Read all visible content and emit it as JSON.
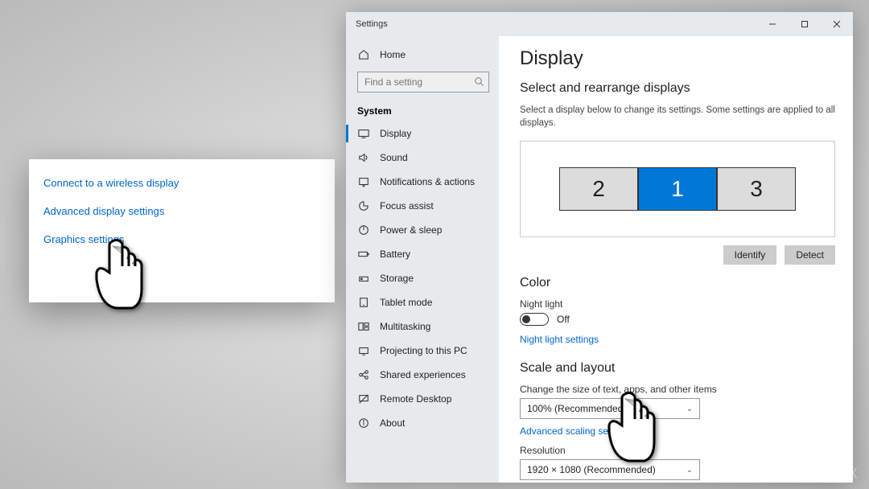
{
  "popup": {
    "links": [
      "Connect to a wireless display",
      "Advanced display settings",
      "Graphics settings"
    ]
  },
  "window": {
    "title": "Settings"
  },
  "sidebar": {
    "home": "Home",
    "search_placeholder": "Find a setting",
    "heading": "System",
    "items": [
      "Display",
      "Sound",
      "Notifications & actions",
      "Focus assist",
      "Power & sleep",
      "Battery",
      "Storage",
      "Tablet mode",
      "Multitasking",
      "Projecting to this PC",
      "Shared experiences",
      "Remote Desktop",
      "About"
    ]
  },
  "content": {
    "title": "Display",
    "arrange_heading": "Select and rearrange displays",
    "arrange_sub": "Select a display below to change its settings. Some settings are applied to all displays.",
    "displays": [
      "2",
      "1",
      "3"
    ],
    "identify": "Identify",
    "detect": "Detect",
    "color_heading": "Color",
    "night_light_label": "Night light",
    "night_light_state": "Off",
    "night_light_link": "Night light settings",
    "scale_heading": "Scale and layout",
    "scale_label": "Change the size of text, apps, and other items",
    "scale_value": "100% (Recommended)",
    "advanced_scaling": "Advanced scaling settings",
    "resolution_label": "Resolution",
    "resolution_value": "1920 × 1080 (Recommended)"
  },
  "watermark": "UGETFIX"
}
